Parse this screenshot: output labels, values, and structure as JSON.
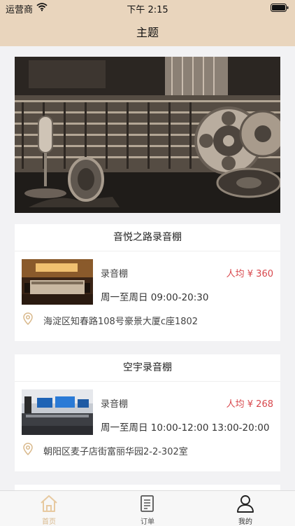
{
  "status_bar": {
    "carrier": "运营商",
    "time": "下午 2:15"
  },
  "header": {
    "title": "主题"
  },
  "studios": [
    {
      "name": "音悦之路录音棚",
      "type": "录音棚",
      "price": "人均 ¥ 360",
      "hours": "周一至周日 09:00-20:30",
      "address": "海淀区知春路108号豪景大厦c座1802"
    },
    {
      "name": "空宇录音棚",
      "type": "录音棚",
      "price": "人均 ¥ 268",
      "hours": "周一至周日 10:00-12:00 13:00-20:00",
      "address": "朝阳区麦子店街富丽华园2-2-302室"
    }
  ],
  "tabs": [
    {
      "label": "首页",
      "icon": "home-icon",
      "active": true
    },
    {
      "label": "订单",
      "icon": "order-icon",
      "active": false
    },
    {
      "label": "我的",
      "icon": "profile-icon",
      "active": false
    }
  ],
  "colors": {
    "header_bg": "#e9d5bd",
    "accent": "#d9b98c",
    "price": "#d8474c"
  }
}
